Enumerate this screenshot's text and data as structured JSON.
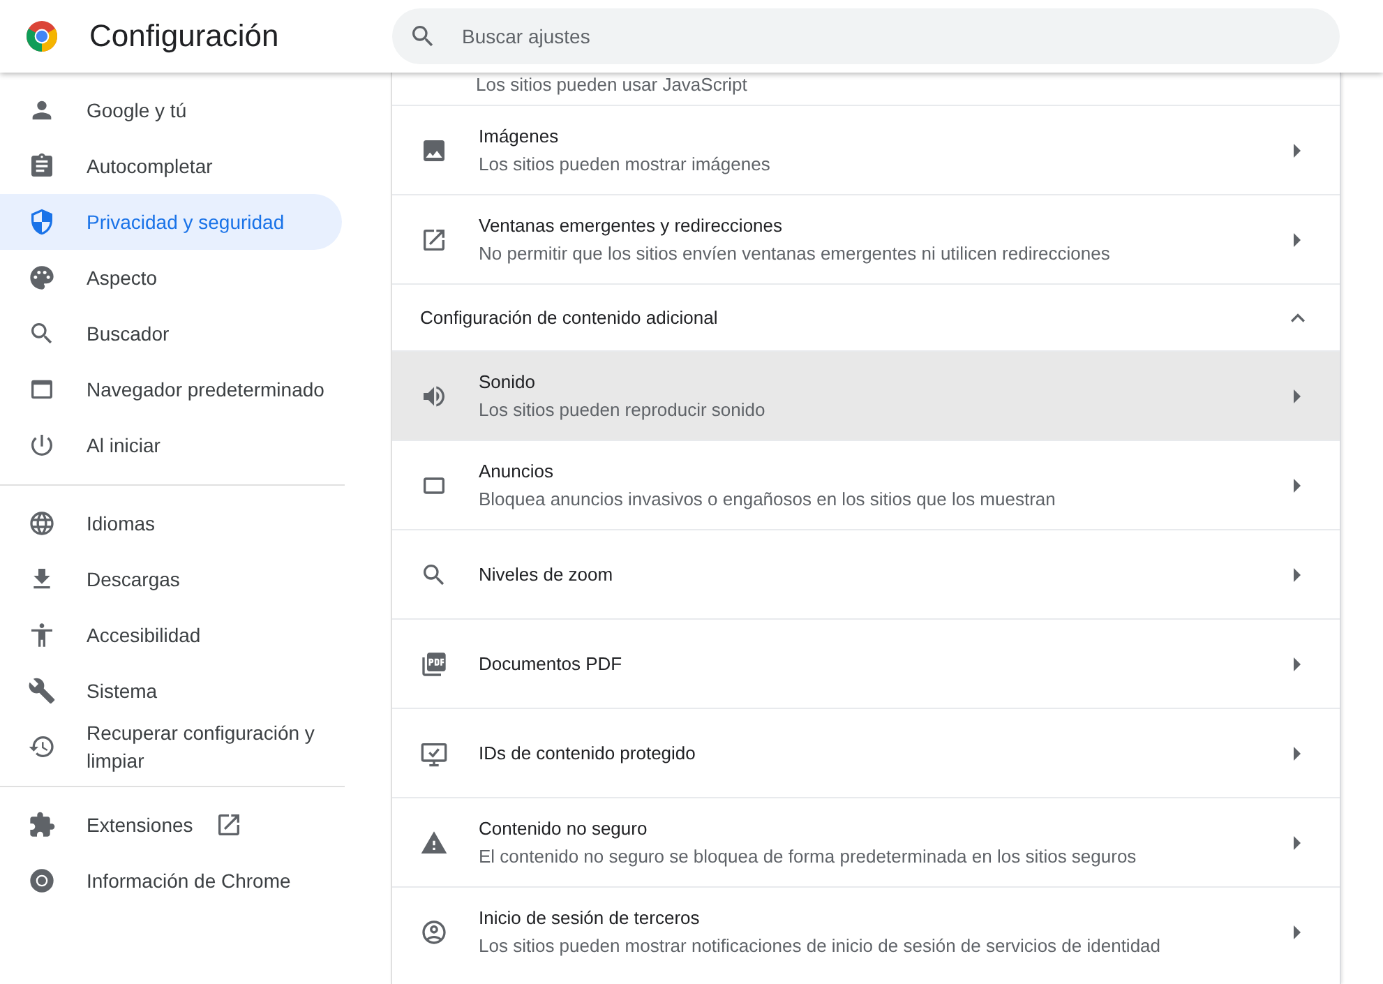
{
  "header": {
    "title": "Configuración",
    "search": {
      "placeholder": "Buscar ajustes"
    }
  },
  "sidebar": {
    "groups": [
      {
        "items": [
          {
            "label": "Google y tú",
            "selected": false
          },
          {
            "label": "Autocompletar",
            "selected": false
          },
          {
            "label": "Privacidad y seguridad",
            "selected": true
          },
          {
            "label": "Aspecto",
            "selected": false
          },
          {
            "label": "Buscador",
            "selected": false
          },
          {
            "label": "Navegador predeterminado",
            "selected": false
          },
          {
            "label": "Al iniciar",
            "selected": false
          }
        ]
      },
      {
        "items": [
          {
            "label": "Idiomas",
            "selected": false
          },
          {
            "label": "Descargas",
            "selected": false
          },
          {
            "label": "Accesibilidad",
            "selected": false
          },
          {
            "label": "Sistema",
            "selected": false
          },
          {
            "label": "Recuperar configuración y limpiar",
            "selected": false
          }
        ]
      },
      {
        "items": [
          {
            "label": "Extensiones",
            "selected": false,
            "external": true
          },
          {
            "label": "Información de Chrome",
            "selected": false
          }
        ]
      }
    ]
  },
  "content": {
    "partial_description": "Los sitios pueden usar JavaScript",
    "rows_top": [
      {
        "title": "Imágenes",
        "description": "Los sitios pueden mostrar imágenes",
        "highlighted": false
      },
      {
        "title": "Ventanas emergentes y redirecciones",
        "description": "No permitir que los sitios envíen ventanas emergentes ni utilicen redirecciones",
        "highlighted": false
      }
    ],
    "section": {
      "title": "Configuración de contenido adicional",
      "expanded": true
    },
    "rows": [
      {
        "title": "Sonido",
        "description": "Los sitios pueden reproducir sonido",
        "highlighted": true
      },
      {
        "title": "Anuncios",
        "description": "Bloquea anuncios invasivos o engañosos en los sitios que los muestran",
        "highlighted": false
      },
      {
        "title": "Niveles de zoom",
        "highlighted": false
      },
      {
        "title": "Documentos PDF",
        "highlighted": false
      },
      {
        "title": "IDs de contenido protegido",
        "highlighted": false
      },
      {
        "title": "Contenido no seguro",
        "description": "El contenido no seguro se bloquea de forma predeterminada en los sitios seguros",
        "highlighted": false
      },
      {
        "title": "Inicio de sesión de terceros",
        "description": "Los sitios pueden mostrar notificaciones de inicio de sesión de servicios de identidad",
        "highlighted": false
      }
    ]
  }
}
